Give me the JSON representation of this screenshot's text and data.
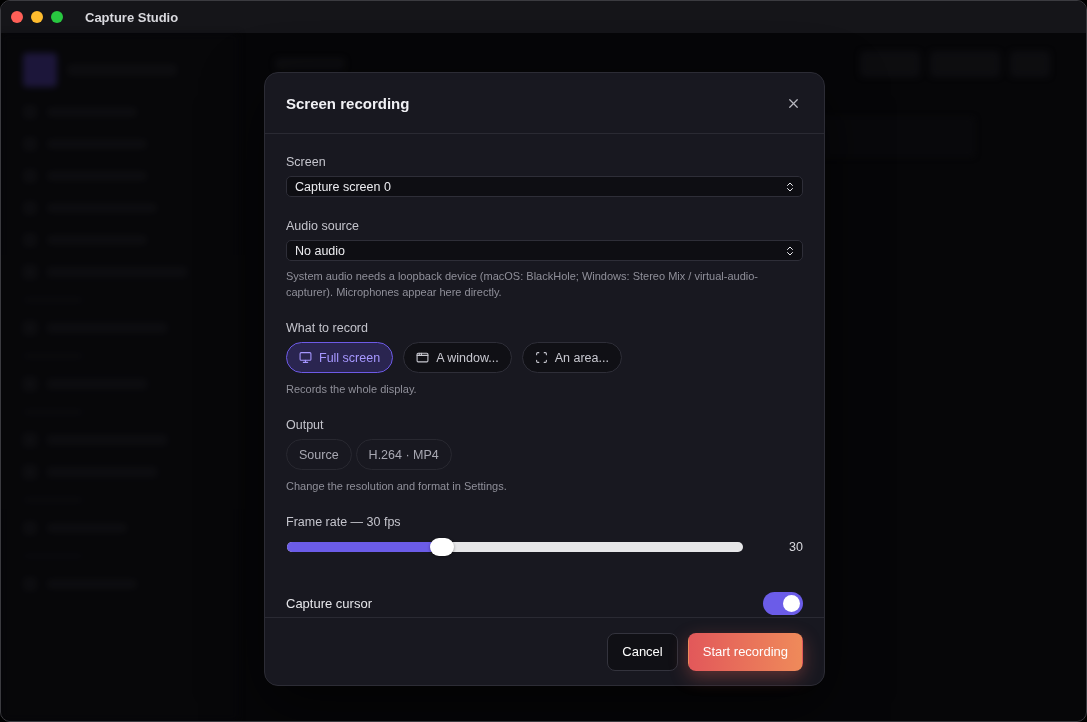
{
  "window": {
    "title": "Capture Studio"
  },
  "dialog": {
    "title": "Screen recording",
    "screen": {
      "label": "Screen",
      "value": "Capture screen 0"
    },
    "audio": {
      "label": "Audio source",
      "value": "No audio",
      "hint": "System audio needs a loopback device (macOS: BlackHole; Windows: Stereo Mix / virtual-audio-capturer). Microphones appear here directly."
    },
    "target": {
      "label": "What to record",
      "options": [
        {
          "label": "Full screen",
          "selected": true
        },
        {
          "label": "A window...",
          "selected": false
        },
        {
          "label": "An area...",
          "selected": false
        }
      ],
      "hint": "Records the whole display."
    },
    "output": {
      "label": "Output",
      "chips": [
        "Source",
        "H.264 · MP4"
      ],
      "hint": "Change the resolution and format in Settings."
    },
    "frame_rate": {
      "label": "Frame rate — 30 fps",
      "level": 0.34,
      "reading": "30"
    },
    "cursor": {
      "label": "Capture cursor",
      "on": true
    },
    "buttons": [
      {
        "label": "Cancel",
        "kind": "secondary"
      },
      {
        "label": "Start recording",
        "kind": "primary"
      }
    ]
  }
}
